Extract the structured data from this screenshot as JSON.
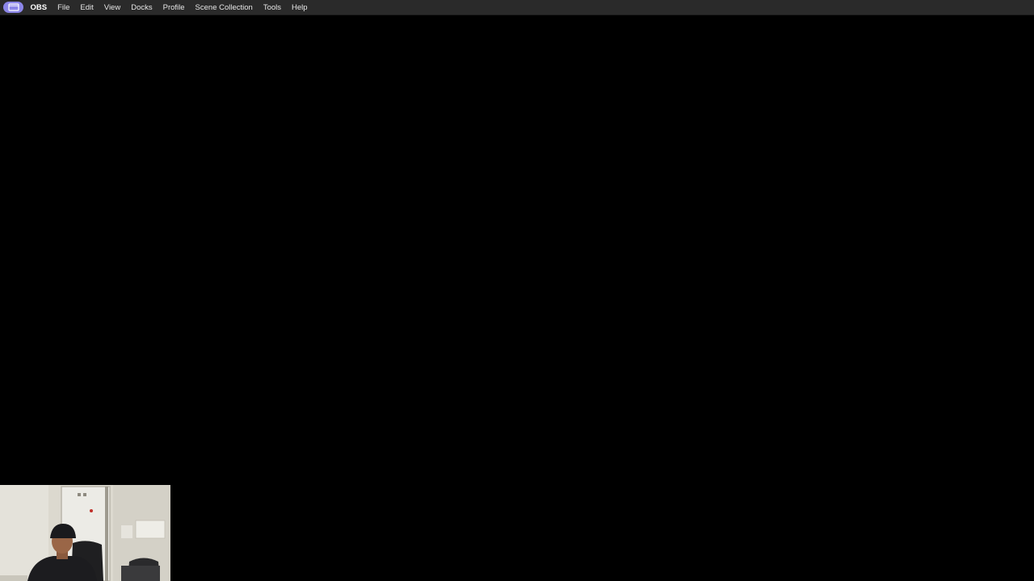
{
  "menubar": {
    "app_icon": "obs-app-icon",
    "app_name": "OBS",
    "items": [
      "File",
      "Edit",
      "View",
      "Docks",
      "Profile",
      "Scene Collection",
      "Tools",
      "Help"
    ]
  },
  "colors": {
    "menubar_bg": "#2a2a2a",
    "accent_pill": "#8c86e8",
    "preview_bg": "#000000"
  }
}
